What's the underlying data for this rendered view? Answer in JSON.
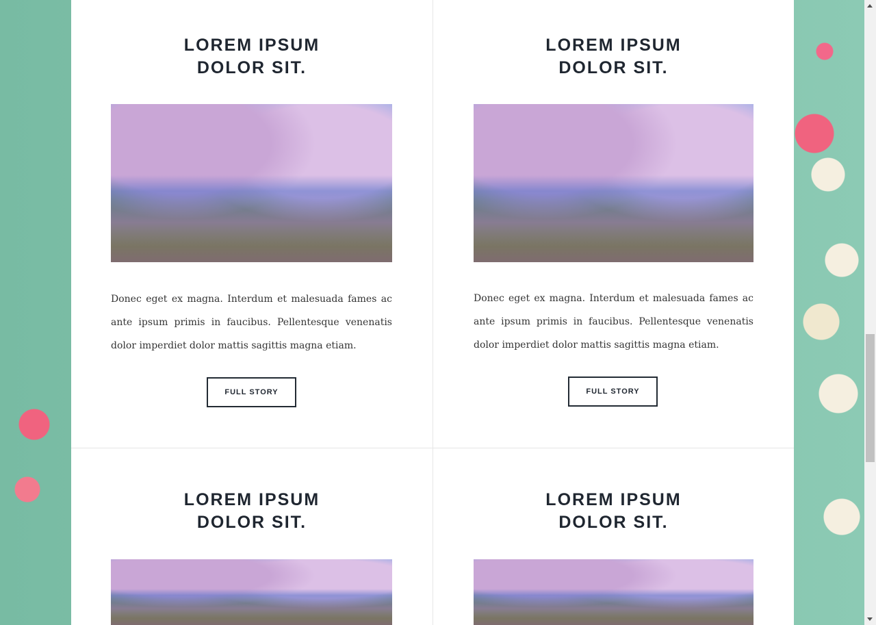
{
  "cards": [
    {
      "title_line1": "LOREM IPSUM",
      "title_line2": "DOLOR SIT.",
      "text": "Donec eget ex magna. Interdum et malesuada fames ac ante ipsum primis in faucibus. Pellentesque venenatis dolor imperdiet dolor mattis sagittis magna etiam.",
      "button": "FULL STORY"
    },
    {
      "title_line1": "LOREM IPSUM",
      "title_line2": "DOLOR SIT.",
      "text": "Donec eget ex magna. Interdum et malesuada fames ac ante ipsum primis in faucibus. Pellentesque venenatis dolor imperdiet dolor mattis sagittis magna etiam.",
      "button": "FULL STORY"
    },
    {
      "title_line1": "LOREM IPSUM",
      "title_line2": "DOLOR SIT."
    },
    {
      "title_line1": "LOREM IPSUM",
      "title_line2": "DOLOR SIT."
    }
  ],
  "scrollbar": {
    "position_fraction": 0.6
  }
}
